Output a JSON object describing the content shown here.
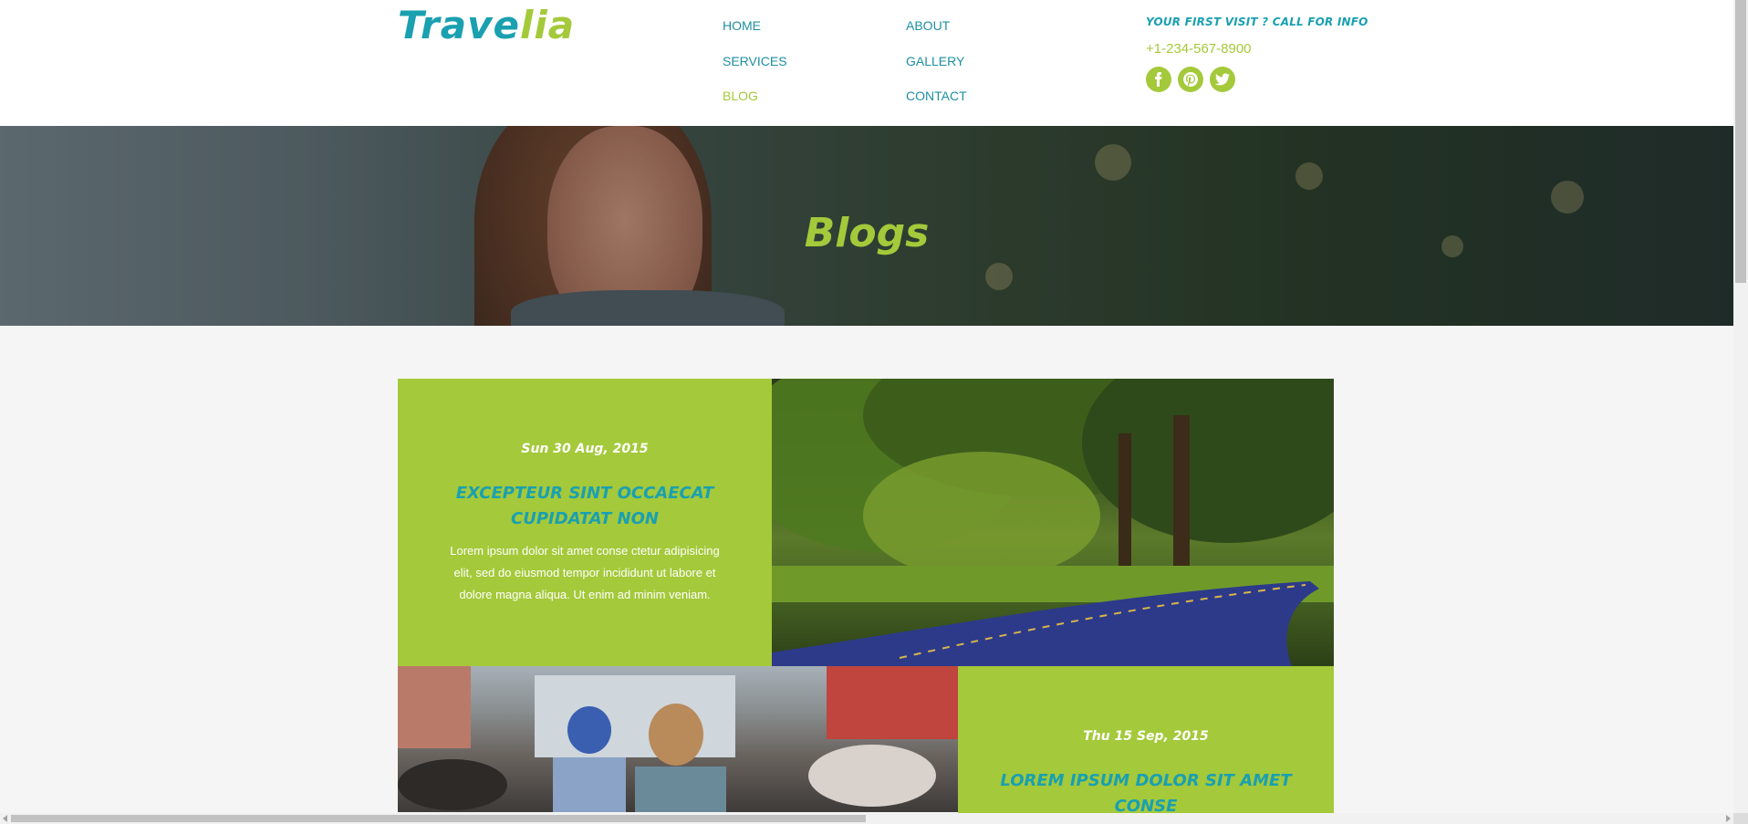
{
  "header": {
    "logo_part1": "Trave",
    "logo_part2": "lia",
    "nav": [
      "HOME",
      "ABOUT",
      "SERVICES",
      "GALLERY",
      "BLOG",
      "CONTACT"
    ],
    "active_nav": "BLOG",
    "info_title": "YOUR FIRST VISIT ? CALL FOR INFO",
    "phone": "+1-234-567-8900",
    "social_icons": [
      "facebook-icon",
      "pinterest-icon",
      "twitter-icon"
    ]
  },
  "banner": {
    "title": "Blogs"
  },
  "posts": [
    {
      "date": "Sun 30 Aug, 2015",
      "title_line1": "EXCEPTEUR SINT OCCAECAT",
      "title_line2": "CUPIDATAT NON",
      "body_line1": "Lorem ipsum dolor sit amet conse ctetur adipisicing",
      "body_line2": "elit, sed do eiusmod tempor incididunt ut labore et",
      "body_line3": "dolore magna aliqua. Ut enim ad minim veniam."
    },
    {
      "date": "Thu 15 Sep, 2015",
      "title_line1": "LOREM IPSUM DOLOR SIT AMET",
      "title_line2": "CONSE"
    }
  ],
  "colors": {
    "accent_green": "#a4c93a",
    "accent_teal": "#1aa0b0",
    "page_bg": "#f5f5f5"
  }
}
